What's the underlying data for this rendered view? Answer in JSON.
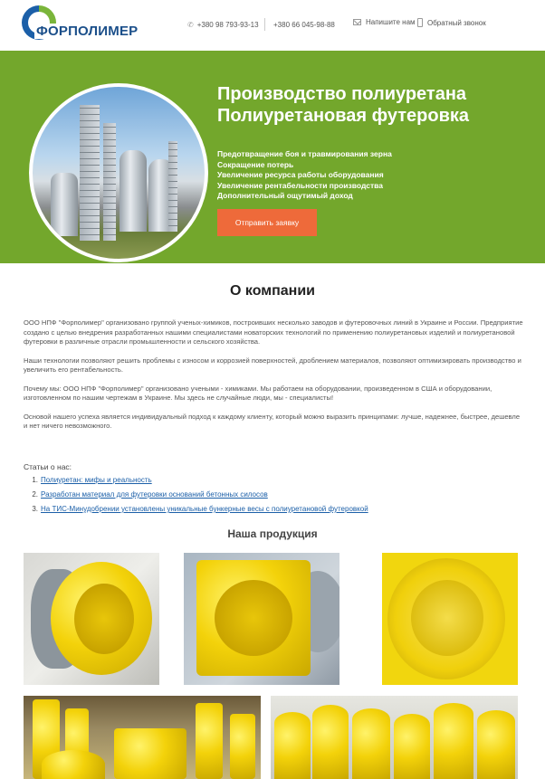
{
  "header": {
    "logo_text": "ФОРПОЛИМЕР",
    "phone1": "+380 98 793-93-13",
    "phone2": "+380 66 045-98-88",
    "write_us": "Напишите нам",
    "callback": "Обратный звонок"
  },
  "hero": {
    "title_line1": "Производство полиуретана",
    "title_line2": "Полиуретановая футеровка",
    "benefits": [
      "Предотвращение боя и травмирования зерна",
      "Сокращение потерь",
      "Увеличение ресурса работы оборудования",
      "Увеличение рентабельности производства",
      "Дополнительный ощутимый доход"
    ],
    "cta_label": "Отправить заявку"
  },
  "about": {
    "title": "О компании",
    "paragraphs": [
      "ООО НПФ \"Форполимер\" организовано группой ученых-химиков, построивших несколько заводов и футеровочных линий в Украине и России. Предприятие создано с целью внедрения разработанных нашими специалистами новаторских технологий по применению полиуретановых изделий и полиуретановой футеровки в различные отрасли промышленности и сельского хозяйства.",
      "Наши технологии позволяют решить проблемы с износом и коррозией поверхностей, дроблением материалов, позволяют оптимизировать производство и увеличить его рентабельность.",
      "Почему мы: ООО НПФ \"Форполимер\" организовано учеными - химиками. Мы работаем на оборудовании, произведенном в США и оборудовании, изготовленном по нашим чертежам в Украине. Мы здесь не случайные люди, мы - специалисты!",
      "Основой нашего успеха является индивидуальный подход к каждому клиенту, который можно выразить принципами: лучше, надежнее, быстрее, дешевле и нет ничего невозможного."
    ],
    "articles_heading": "Статьи о нас:",
    "articles": [
      "Полиуретан: мифы и реальность",
      "Разработан материал для футеровки оснований бетонных силосов",
      "На ТИС-Минудобрении установлены уникальные бункерные весы с полиуретановой футеровкой"
    ]
  },
  "products": {
    "title": "Наша продукция"
  },
  "colors": {
    "hero_green": "#73a72c",
    "cta_orange": "#ee6a3a",
    "link_blue": "#1b5fa8",
    "product_yellow": "#f3d20a"
  }
}
